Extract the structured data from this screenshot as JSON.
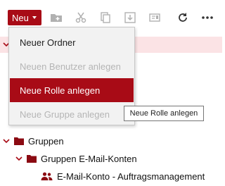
{
  "toolbar": {
    "new_label": "Neu",
    "icons": [
      "new-folder-icon",
      "cut-icon",
      "copy-icon",
      "download-icon",
      "id-card-icon",
      "refresh-icon",
      "more-icon"
    ]
  },
  "dropdown_menu": {
    "items": [
      {
        "label": "Neuer Ordner",
        "enabled": true
      },
      {
        "label": "Neuen Benutzer anlegen",
        "enabled": false
      },
      {
        "label": "Neue Rolle anlegen",
        "enabled": true,
        "highlighted": true
      },
      {
        "label": "Neue Gruppe anlegen",
        "enabled": false
      }
    ]
  },
  "tooltip": {
    "text": "Neue Rolle anlegen"
  },
  "tree": {
    "nodes": [
      {
        "label": "Gruppen",
        "type": "folder",
        "expanded": true
      },
      {
        "label": "Gruppen E-Mail-Konten",
        "type": "folder",
        "expanded": true
      },
      {
        "label": "E-Mail-Konto - Auftragsmanagement",
        "type": "users"
      }
    ]
  },
  "colors": {
    "accent": "#a80b16",
    "menu_background": "#f2f2f2",
    "selected_row_background": "#fbe3e5",
    "disabled_text": "#b5b5b5"
  }
}
